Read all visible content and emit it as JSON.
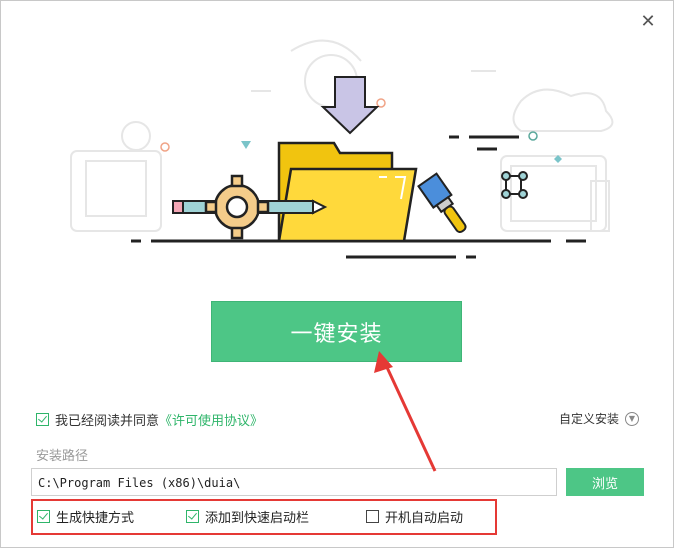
{
  "window": {
    "close_glyph": "✕"
  },
  "install": {
    "button_label": "一键安装"
  },
  "agreement": {
    "text": "我已经阅读并同意",
    "link": "《许可使用协议》",
    "checked": true
  },
  "custom_install": {
    "label": "自定义安装",
    "icon": "chevron-down-icon"
  },
  "install_path": {
    "label": "安装路径",
    "value": "C:\\Program Files (x86)\\duia\\",
    "browse_label": "浏览"
  },
  "options": [
    {
      "label": "生成快捷方式",
      "checked": true
    },
    {
      "label": "添加到快速启动栏",
      "checked": true
    },
    {
      "label": "开机自动启动",
      "checked": false
    }
  ],
  "colors": {
    "accent": "#4dc686",
    "highlight": "#e53935"
  }
}
